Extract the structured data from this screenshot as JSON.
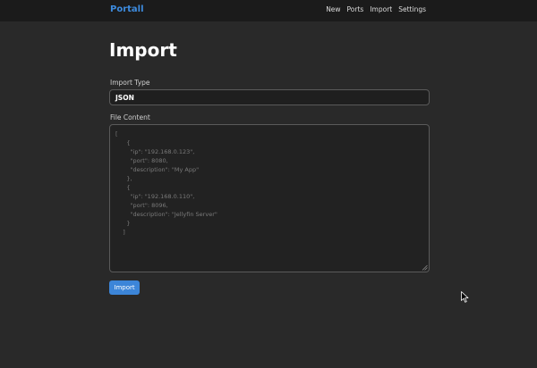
{
  "nav": {
    "brand": "Portall",
    "links": [
      "New",
      "Ports",
      "Import",
      "Settings"
    ]
  },
  "page": {
    "title": "Import"
  },
  "form": {
    "import_type_label": "Import Type",
    "import_type_value": "JSON",
    "file_content_label": "File Content",
    "file_content_placeholder": "[\n      {\n        \"ip\": \"192.168.0.123\",\n        \"port\": 8080,\n        \"description\": \"My App\"\n      },\n      {\n        \"ip\": \"192.168.0.110\",\n        \"port\": 8096,\n        \"description\": \"Jellyfin Server\"\n      }\n    ]",
    "submit_label": "Import"
  },
  "colors": {
    "accent": "#3c85d8",
    "background": "#292929",
    "navbar": "#1b1b1b"
  },
  "icons": {
    "cursor": "mouse-pointer-icon",
    "resize": "resize-grip-icon"
  }
}
